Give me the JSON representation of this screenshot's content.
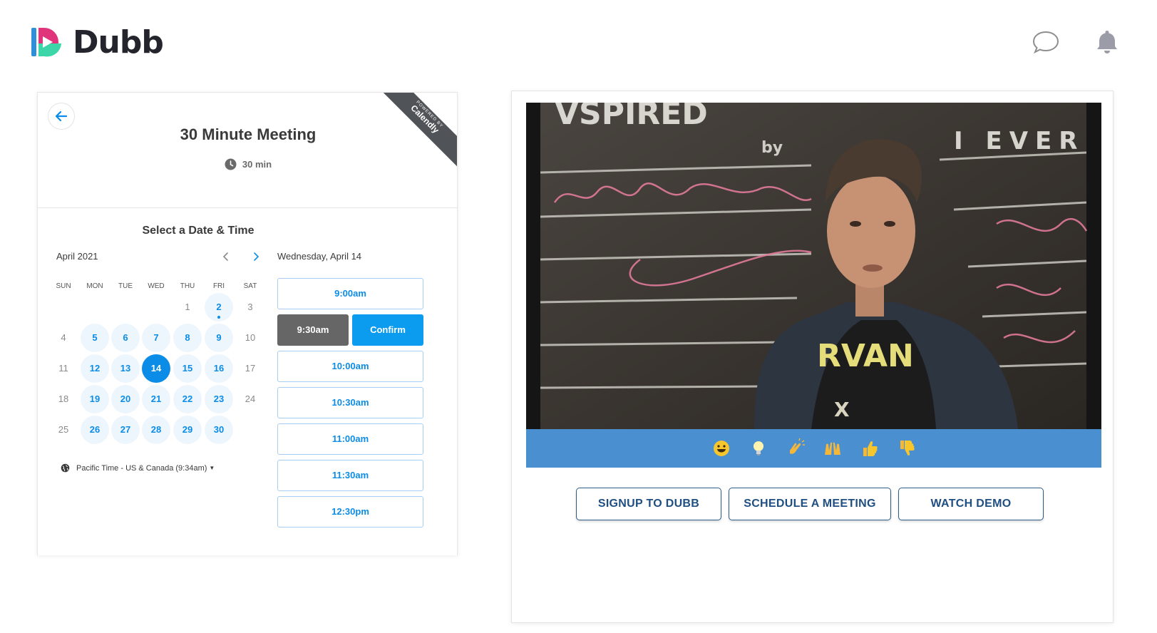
{
  "brand": {
    "name": "Dubb"
  },
  "header": {
    "chat_icon": "chat-bubble-icon",
    "bell_icon": "bell-icon"
  },
  "calendly": {
    "ribbon_small": "POWERED BY",
    "ribbon_brand": "Calendly",
    "title": "30 Minute Meeting",
    "duration": "30 min",
    "select_title": "Select a Date & Time",
    "month": "April 2021",
    "weekdays": [
      "SUN",
      "MON",
      "TUE",
      "WED",
      "THU",
      "FRI",
      "SAT"
    ],
    "days": {
      "d1": "1",
      "d2": "2",
      "d3": "3",
      "d4": "4",
      "d5": "5",
      "d6": "6",
      "d7": "7",
      "d8": "8",
      "d9": "9",
      "d10": "10",
      "d11": "11",
      "d12": "12",
      "d13": "13",
      "d14": "14",
      "d15": "15",
      "d16": "16",
      "d17": "17",
      "d18": "18",
      "d19": "19",
      "d20": "20",
      "d21": "21",
      "d22": "22",
      "d23": "23",
      "d24": "24",
      "d25": "25",
      "d26": "26",
      "d27": "27",
      "d28": "28",
      "d29": "29",
      "d30": "30"
    },
    "selected_day": "14",
    "timezone": "Pacific Time - US & Canada (9:34am)",
    "date_label": "Wednesday, April 14",
    "slots": {
      "s900": "9:00am",
      "s930": "9:30am",
      "confirm": "Confirm",
      "s1000": "10:00am",
      "s1030": "10:30am",
      "s1100": "11:00am",
      "s1130": "11:30am",
      "s1230": "12:30pm"
    }
  },
  "video": {
    "reactions": [
      "grinning-face-icon",
      "light-bulb-icon",
      "clapping-hands-icon",
      "raised-hands-icon",
      "thumbs-up-icon",
      "thumbs-down-icon"
    ],
    "buttons": {
      "signup": "SIGNUP TO DUBB",
      "schedule": "SCHEDULE A MEETING",
      "demo": "WATCH DEMO"
    }
  },
  "colors": {
    "accent": "#0b8ce6",
    "reaction_bar": "#4a8fd0",
    "cta_text": "#1f4f82"
  }
}
